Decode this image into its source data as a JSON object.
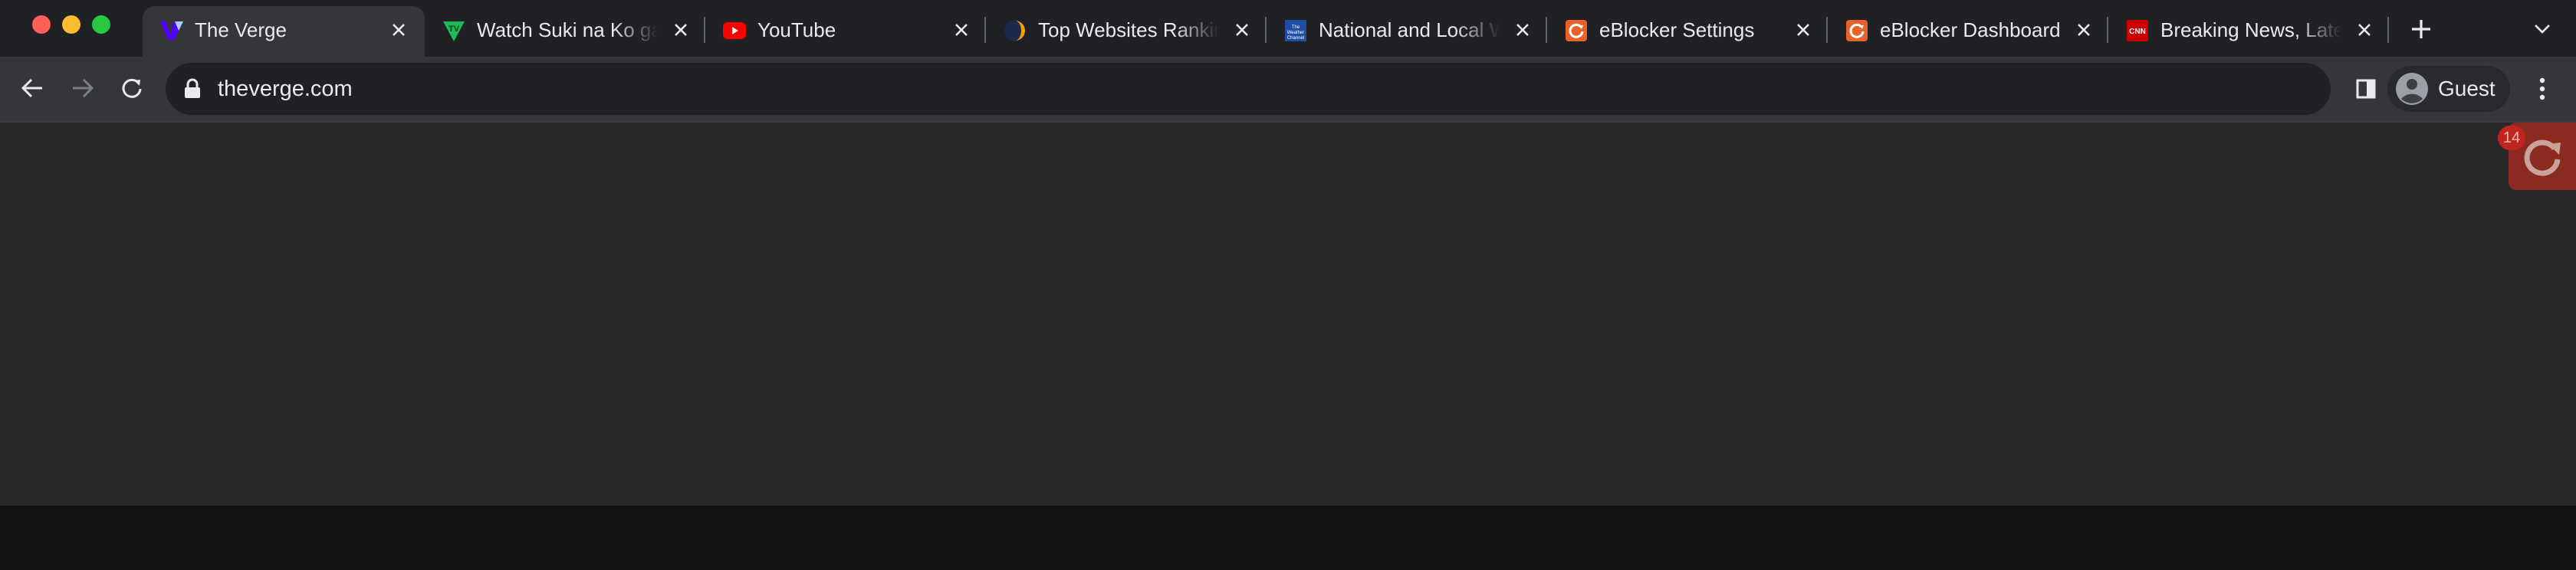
{
  "browser": {
    "tabs": [
      {
        "title": "The Verge",
        "active": true,
        "favicon": "verge-logo-icon",
        "color": "#5200ff"
      },
      {
        "title": "Watch Suki na Ko ga",
        "active": false,
        "favicon": "tv-logo-icon",
        "color": "#1db954"
      },
      {
        "title": "YouTube",
        "active": false,
        "favicon": "youtube-icon",
        "color": "#ff0000"
      },
      {
        "title": "Top Websites Rankin",
        "active": false,
        "favicon": "similarweb-icon",
        "color": "#f59e0b"
      },
      {
        "title": "National and Local W",
        "active": false,
        "favicon": "weather-channel-icon",
        "color": "#1f4ea3"
      },
      {
        "title": "eBlocker Settings",
        "active": false,
        "favicon": "eblocker-icon",
        "color": "#e8632c"
      },
      {
        "title": "eBlocker Dashboard",
        "active": false,
        "favicon": "eblocker-icon",
        "color": "#e8632c"
      },
      {
        "title": "Breaking News, Lates",
        "active": false,
        "favicon": "cnn-icon",
        "color": "#cc0000"
      }
    ],
    "favicon_text": {
      "tv": "TV",
      "cnn": "CNN",
      "weather": "The Weather Channel"
    },
    "url": "theverge.com",
    "profile": "Guest",
    "extension_badge": "14"
  },
  "colors": {
    "titlebar": "#202124",
    "toolbar": "#35363a",
    "omnibox": "#202124",
    "page_background": "#282828",
    "extension_accent": "#8b2a1e"
  }
}
